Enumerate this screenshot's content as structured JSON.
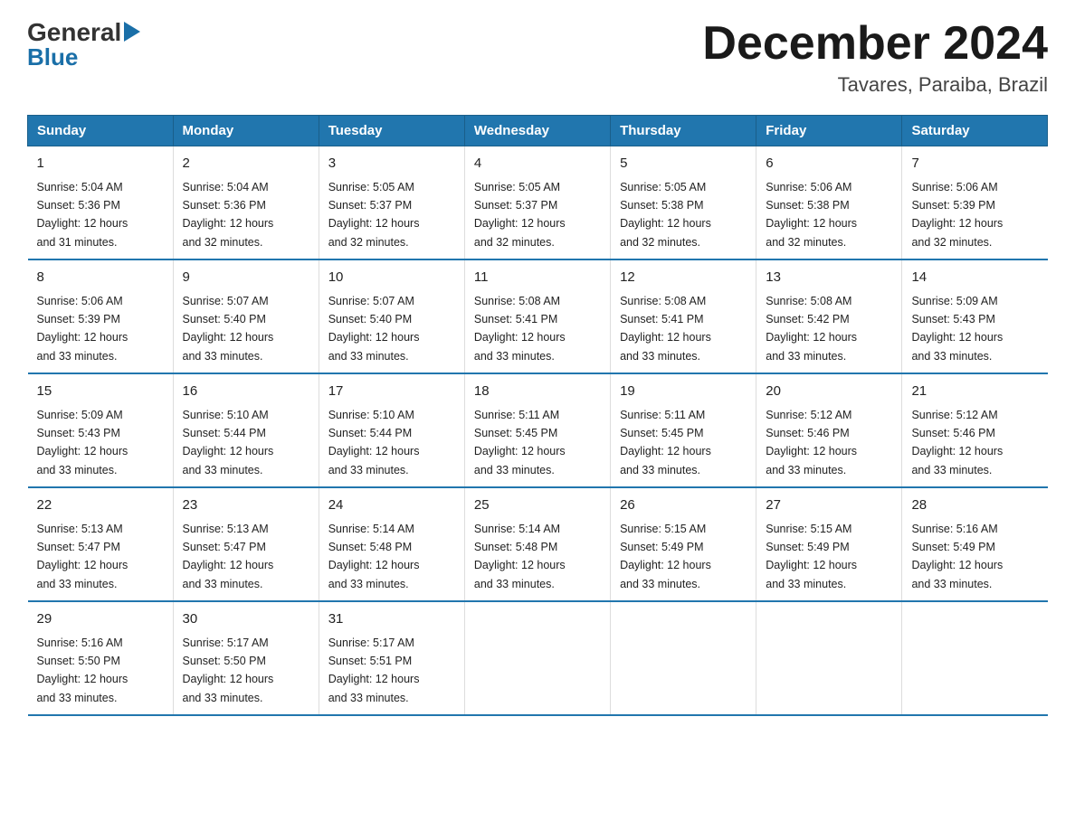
{
  "header": {
    "logo_general": "General",
    "logo_blue": "Blue",
    "title": "December 2024",
    "subtitle": "Tavares, Paraiba, Brazil"
  },
  "calendar": {
    "days_of_week": [
      "Sunday",
      "Monday",
      "Tuesday",
      "Wednesday",
      "Thursday",
      "Friday",
      "Saturday"
    ],
    "weeks": [
      [
        {
          "day": "1",
          "sunrise": "5:04 AM",
          "sunset": "5:36 PM",
          "daylight": "12 hours and 31 minutes."
        },
        {
          "day": "2",
          "sunrise": "5:04 AM",
          "sunset": "5:36 PM",
          "daylight": "12 hours and 32 minutes."
        },
        {
          "day": "3",
          "sunrise": "5:05 AM",
          "sunset": "5:37 PM",
          "daylight": "12 hours and 32 minutes."
        },
        {
          "day": "4",
          "sunrise": "5:05 AM",
          "sunset": "5:37 PM",
          "daylight": "12 hours and 32 minutes."
        },
        {
          "day": "5",
          "sunrise": "5:05 AM",
          "sunset": "5:38 PM",
          "daylight": "12 hours and 32 minutes."
        },
        {
          "day": "6",
          "sunrise": "5:06 AM",
          "sunset": "5:38 PM",
          "daylight": "12 hours and 32 minutes."
        },
        {
          "day": "7",
          "sunrise": "5:06 AM",
          "sunset": "5:39 PM",
          "daylight": "12 hours and 32 minutes."
        }
      ],
      [
        {
          "day": "8",
          "sunrise": "5:06 AM",
          "sunset": "5:39 PM",
          "daylight": "12 hours and 33 minutes."
        },
        {
          "day": "9",
          "sunrise": "5:07 AM",
          "sunset": "5:40 PM",
          "daylight": "12 hours and 33 minutes."
        },
        {
          "day": "10",
          "sunrise": "5:07 AM",
          "sunset": "5:40 PM",
          "daylight": "12 hours and 33 minutes."
        },
        {
          "day": "11",
          "sunrise": "5:08 AM",
          "sunset": "5:41 PM",
          "daylight": "12 hours and 33 minutes."
        },
        {
          "day": "12",
          "sunrise": "5:08 AM",
          "sunset": "5:41 PM",
          "daylight": "12 hours and 33 minutes."
        },
        {
          "day": "13",
          "sunrise": "5:08 AM",
          "sunset": "5:42 PM",
          "daylight": "12 hours and 33 minutes."
        },
        {
          "day": "14",
          "sunrise": "5:09 AM",
          "sunset": "5:43 PM",
          "daylight": "12 hours and 33 minutes."
        }
      ],
      [
        {
          "day": "15",
          "sunrise": "5:09 AM",
          "sunset": "5:43 PM",
          "daylight": "12 hours and 33 minutes."
        },
        {
          "day": "16",
          "sunrise": "5:10 AM",
          "sunset": "5:44 PM",
          "daylight": "12 hours and 33 minutes."
        },
        {
          "day": "17",
          "sunrise": "5:10 AM",
          "sunset": "5:44 PM",
          "daylight": "12 hours and 33 minutes."
        },
        {
          "day": "18",
          "sunrise": "5:11 AM",
          "sunset": "5:45 PM",
          "daylight": "12 hours and 33 minutes."
        },
        {
          "day": "19",
          "sunrise": "5:11 AM",
          "sunset": "5:45 PM",
          "daylight": "12 hours and 33 minutes."
        },
        {
          "day": "20",
          "sunrise": "5:12 AM",
          "sunset": "5:46 PM",
          "daylight": "12 hours and 33 minutes."
        },
        {
          "day": "21",
          "sunrise": "5:12 AM",
          "sunset": "5:46 PM",
          "daylight": "12 hours and 33 minutes."
        }
      ],
      [
        {
          "day": "22",
          "sunrise": "5:13 AM",
          "sunset": "5:47 PM",
          "daylight": "12 hours and 33 minutes."
        },
        {
          "day": "23",
          "sunrise": "5:13 AM",
          "sunset": "5:47 PM",
          "daylight": "12 hours and 33 minutes."
        },
        {
          "day": "24",
          "sunrise": "5:14 AM",
          "sunset": "5:48 PM",
          "daylight": "12 hours and 33 minutes."
        },
        {
          "day": "25",
          "sunrise": "5:14 AM",
          "sunset": "5:48 PM",
          "daylight": "12 hours and 33 minutes."
        },
        {
          "day": "26",
          "sunrise": "5:15 AM",
          "sunset": "5:49 PM",
          "daylight": "12 hours and 33 minutes."
        },
        {
          "day": "27",
          "sunrise": "5:15 AM",
          "sunset": "5:49 PM",
          "daylight": "12 hours and 33 minutes."
        },
        {
          "day": "28",
          "sunrise": "5:16 AM",
          "sunset": "5:49 PM",
          "daylight": "12 hours and 33 minutes."
        }
      ],
      [
        {
          "day": "29",
          "sunrise": "5:16 AM",
          "sunset": "5:50 PM",
          "daylight": "12 hours and 33 minutes."
        },
        {
          "day": "30",
          "sunrise": "5:17 AM",
          "sunset": "5:50 PM",
          "daylight": "12 hours and 33 minutes."
        },
        {
          "day": "31",
          "sunrise": "5:17 AM",
          "sunset": "5:51 PM",
          "daylight": "12 hours and 33 minutes."
        },
        null,
        null,
        null,
        null
      ]
    ]
  }
}
